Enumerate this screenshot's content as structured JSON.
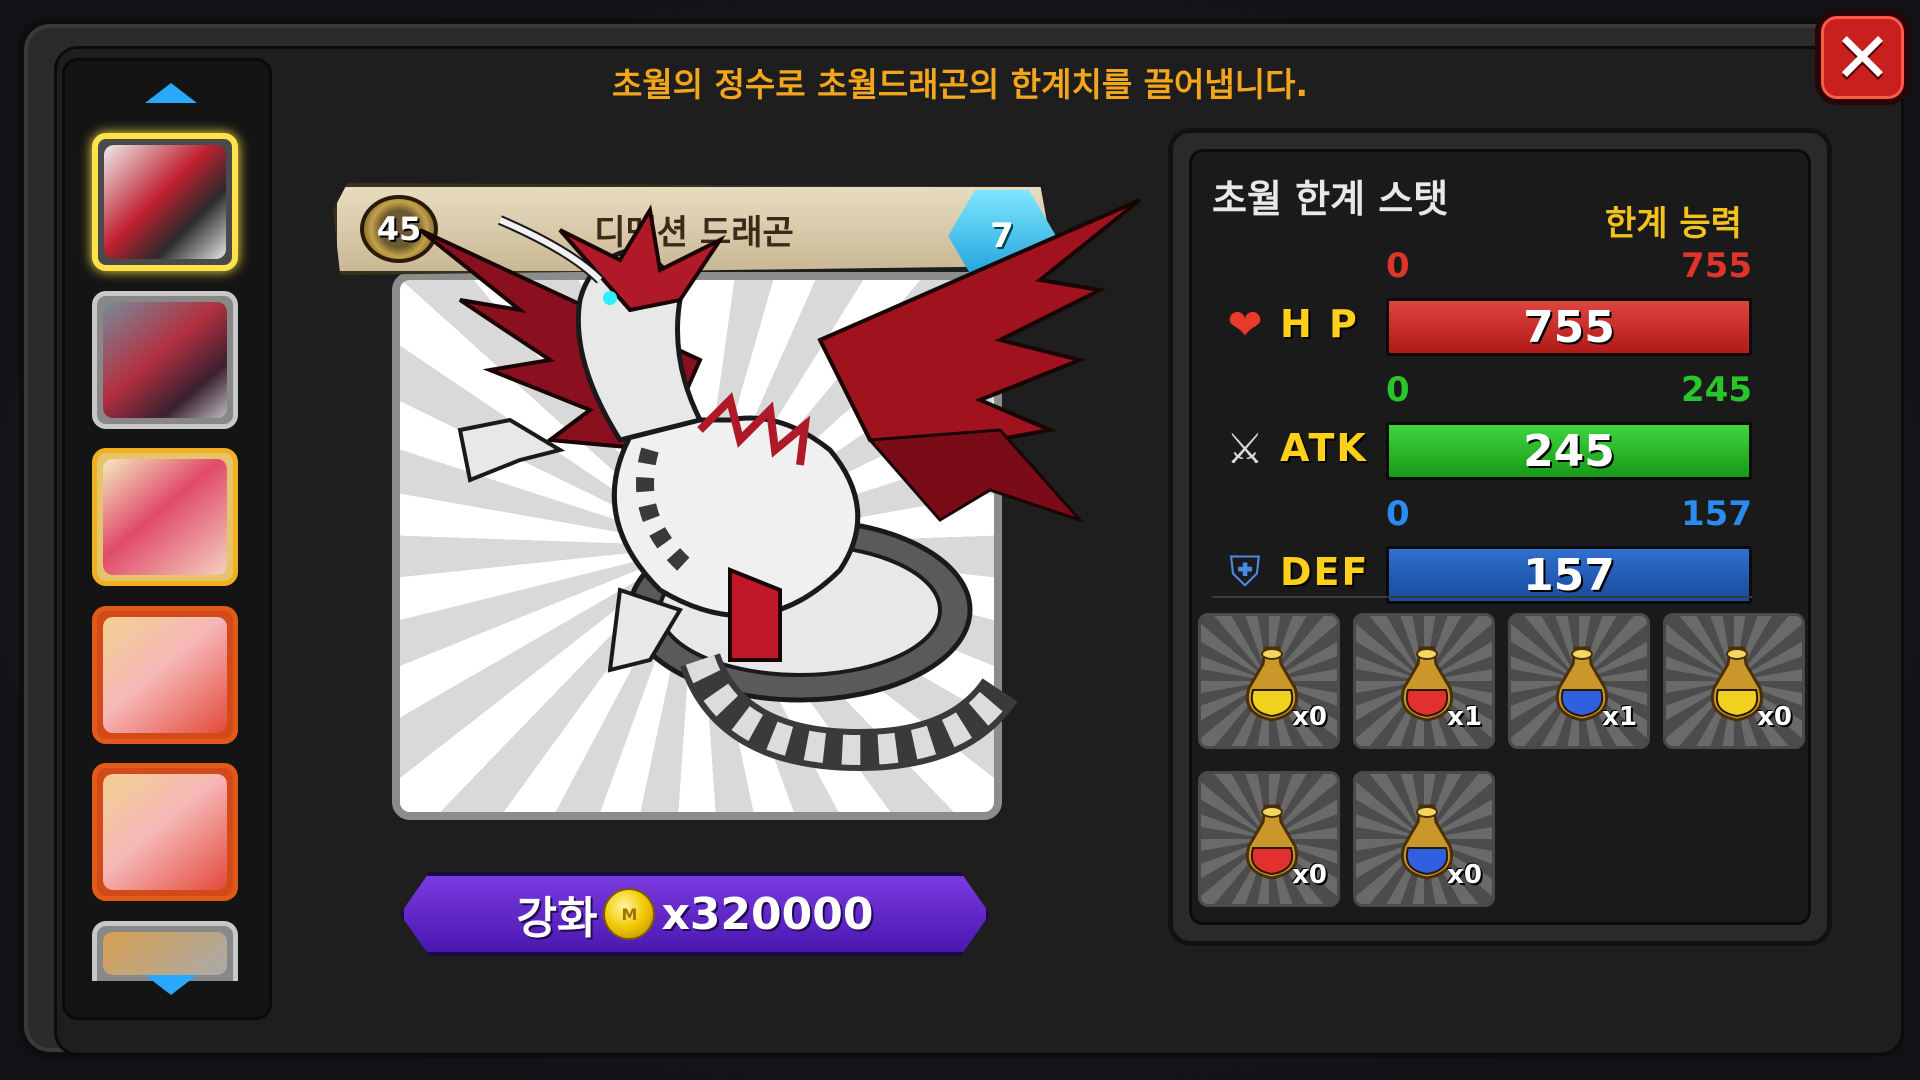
{
  "header": {
    "subtitle": "초월의 정수로 초월드래곤의 한계치를 끌어냅니다."
  },
  "dragon_list": {
    "items": [
      {
        "name": "dimension-dragon",
        "selected": true
      },
      {
        "name": "dragon-2",
        "selected": false
      },
      {
        "name": "dragon-3",
        "selected": false
      },
      {
        "name": "dragon-4",
        "selected": false
      },
      {
        "name": "dragon-5",
        "selected": false
      },
      {
        "name": "dragon-6",
        "selected": false
      }
    ]
  },
  "card": {
    "name": "디멘션 드래곤",
    "level": "45",
    "stars": "7"
  },
  "upgrade": {
    "label": "강화",
    "cost": "x320000"
  },
  "stats": {
    "title": "초월 한계 스탯",
    "limit_label": "한계 능력",
    "hp": {
      "name": "H P",
      "min": "0",
      "max": "755",
      "value": "755",
      "fraction": 1.0,
      "color": "#b01a18"
    },
    "atk": {
      "name": "ATK",
      "min": "0",
      "max": "245",
      "value": "245",
      "fraction": 1.0,
      "color": "#169a16"
    },
    "def": {
      "name": "DEF",
      "min": "0",
      "max": "157",
      "value": "157",
      "fraction": 1.0,
      "color": "#184a9a"
    }
  },
  "potions": [
    {
      "name": "yellow-potion",
      "count": "x0",
      "color": "#f2d020"
    },
    {
      "name": "red-potion",
      "count": "x1",
      "color": "#e23030"
    },
    {
      "name": "blue-potion",
      "count": "x1",
      "color": "#3060e0"
    },
    {
      "name": "large-yellow-potion",
      "count": "x0",
      "color": "#f2d020"
    },
    {
      "name": "large-red-potion",
      "count": "x0",
      "color": "#e23030"
    },
    {
      "name": "large-blue-potion",
      "count": "x0",
      "color": "#3060e0"
    }
  ]
}
